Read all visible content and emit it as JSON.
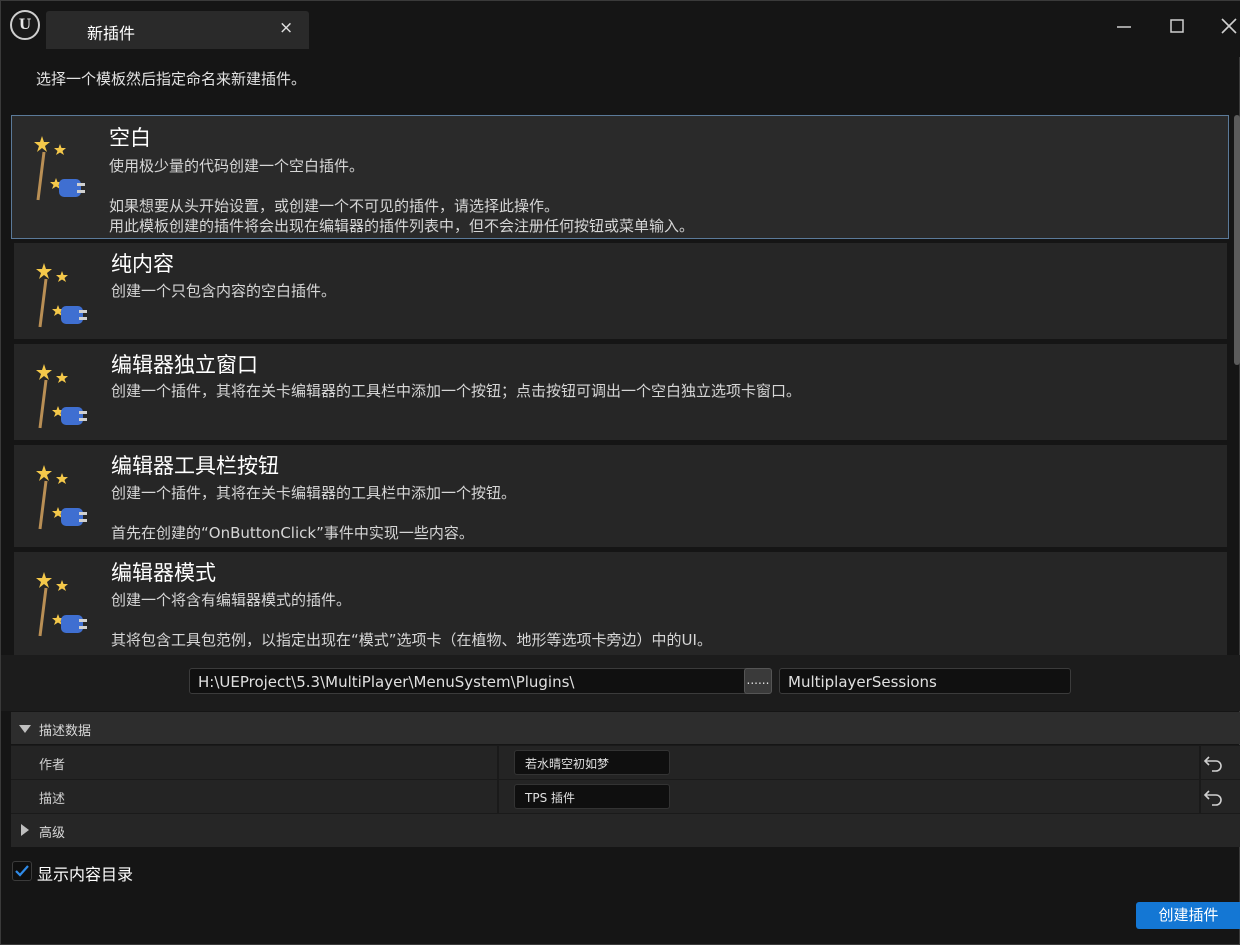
{
  "window": {
    "logo_text": "U",
    "tab_title": "新插件",
    "tab_close": "×"
  },
  "subtitle": "选择一个模板然后指定命名来新建插件。",
  "templates": [
    {
      "title": "空白",
      "description": "使用极少量的代码创建一个空白插件。\n\n如果想要从头开始设置，或创建一个不可见的插件，请选择此操作。\n用此模板创建的插件将会出现在编辑器的插件列表中，但不会注册任何按钮或菜单输入。",
      "selected": true
    },
    {
      "title": "纯内容",
      "description": "创建一个只包含内容的空白插件。",
      "selected": false
    },
    {
      "title": "编辑器独立窗口",
      "description": "创建一个插件，其将在关卡编辑器的工具栏中添加一个按钮；点击按钮可调出一个空白独立选项卡窗口。",
      "selected": false
    },
    {
      "title": "编辑器工具栏按钮",
      "description": "创建一个插件，其将在关卡编辑器的工具栏中添加一个按钮。\n\n首先在创建的“OnButtonClick”事件中实现一些内容。",
      "selected": false
    },
    {
      "title": "编辑器模式",
      "description": "创建一个将含有编辑器模式的插件。\n\n其将包含工具包范例，以指定出现在“模式”选项卡（在植物、地形等选项卡旁边）中的UI。",
      "selected": false
    }
  ],
  "path": {
    "directory": "H:\\UEProject\\5.3\\MultiPlayer\\MenuSystem\\Plugins\\",
    "browse_label": "......",
    "plugin_name": "MultiplayerSessions"
  },
  "details": {
    "section_title": "描述数据",
    "rows": [
      {
        "label": "作者",
        "value": "若水晴空初如梦"
      },
      {
        "label": "描述",
        "value": "TPS 插件"
      }
    ],
    "advanced_label": "高级"
  },
  "show_content_dir": {
    "label": "显示内容目录",
    "checked": true
  },
  "create_button": "创建插件",
  "colors": {
    "accent": "#1477d4",
    "background": "#151515",
    "panel": "#262626",
    "selected_border": "#5b7a99"
  },
  "icons": [
    "plugin-wand-icon",
    "minimize-icon",
    "maximize-icon",
    "close-icon",
    "reset-arrow-icon",
    "checkmark-icon"
  ]
}
